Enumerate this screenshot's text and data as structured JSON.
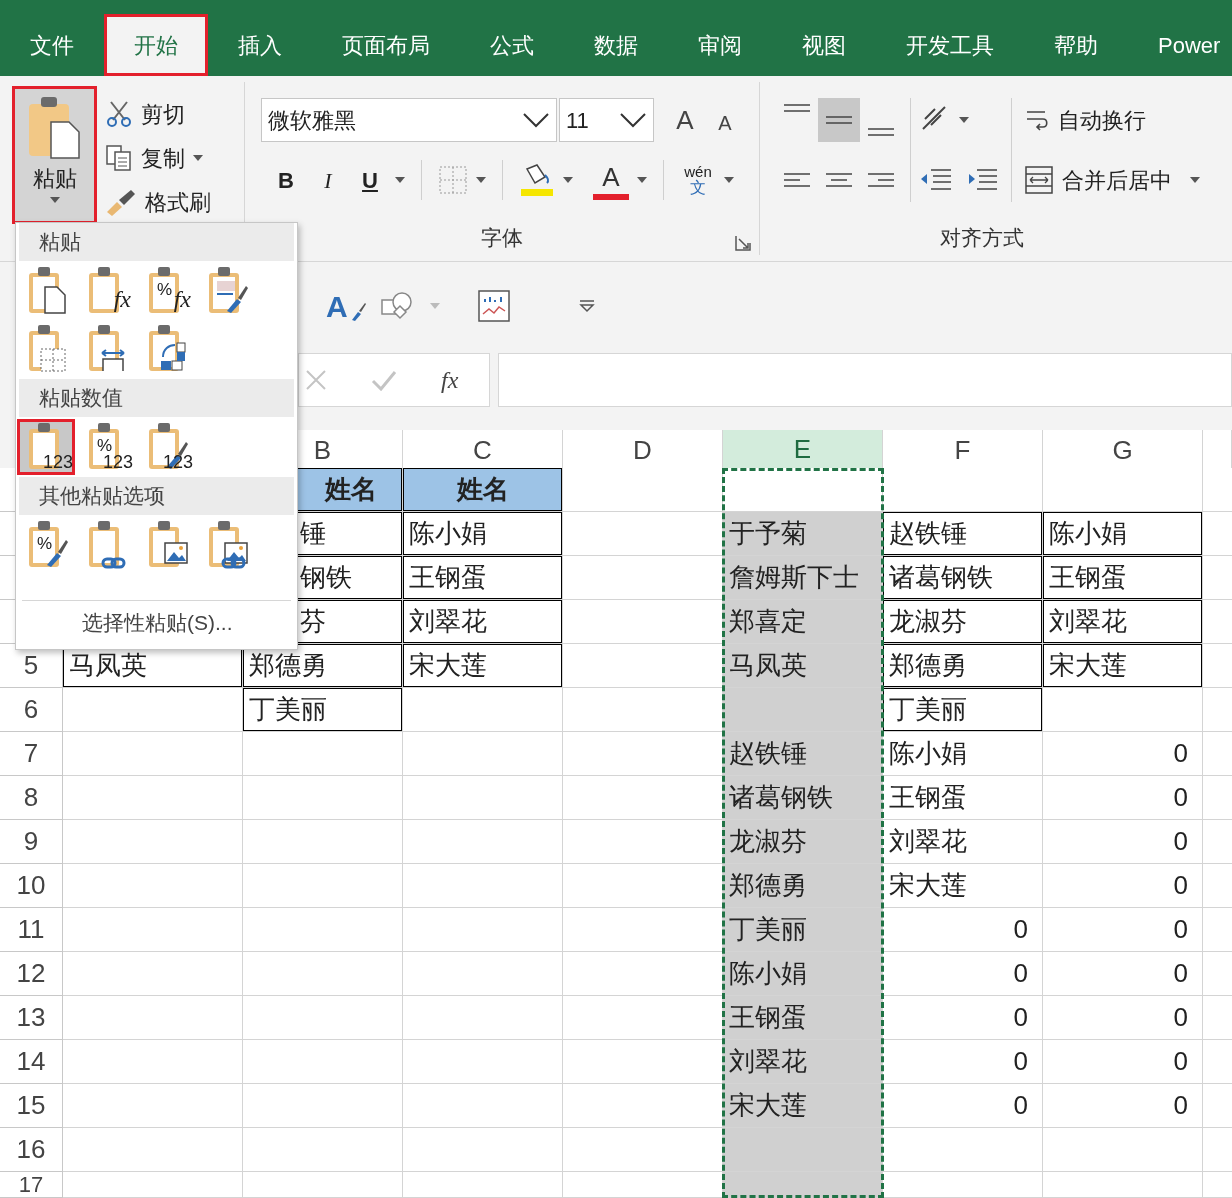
{
  "tabs": [
    {
      "label": "文件",
      "selected": false,
      "highlighted": false
    },
    {
      "label": "开始",
      "selected": true,
      "highlighted": true
    },
    {
      "label": "插入",
      "selected": false,
      "highlighted": false
    },
    {
      "label": "页面布局",
      "selected": false,
      "highlighted": false
    },
    {
      "label": "公式",
      "selected": false,
      "highlighted": false
    },
    {
      "label": "数据",
      "selected": false,
      "highlighted": false
    },
    {
      "label": "审阅",
      "selected": false,
      "highlighted": false
    },
    {
      "label": "视图",
      "selected": false,
      "highlighted": false
    },
    {
      "label": "开发工具",
      "selected": false,
      "highlighted": false
    },
    {
      "label": "帮助",
      "selected": false,
      "highlighted": false
    },
    {
      "label": "Power",
      "selected": false,
      "highlighted": false
    }
  ],
  "ribbon": {
    "clipboard": {
      "paste": {
        "label": "粘贴",
        "highlighted": true
      },
      "cut": "剪切",
      "copy": "复制",
      "format_painter": "格式刷"
    },
    "font": {
      "font_name": "微软雅黑",
      "font_size": "11",
      "grow": "A",
      "shrink": "A",
      "bold": "B",
      "italic": "I",
      "underline": "U",
      "font_color": "A",
      "phonetic": "wén",
      "phonetic_char": "文",
      "group_label": "字体"
    },
    "alignment": {
      "vertical": [
        {
          "kind": "top",
          "selected": false
        },
        {
          "kind": "middle",
          "selected": true
        },
        {
          "kind": "bottom",
          "selected": false
        }
      ],
      "horizontal": [
        {
          "kind": "left",
          "selected": false
        },
        {
          "kind": "center",
          "selected": false
        },
        {
          "kind": "right",
          "selected": false
        }
      ],
      "wrap_text": "自动换行",
      "merge_center": "合并后居中",
      "group_label": "对齐方式"
    }
  },
  "quick_access": {
    "style_letter": "A"
  },
  "formula_bar": {
    "fx": "fx"
  },
  "sheet": {
    "columns": [
      {},
      {
        "label": "B",
        "selected": false
      },
      {
        "label": "C",
        "selected": false
      },
      {
        "label": "D",
        "selected": false
      },
      {
        "label": "E",
        "selected": true
      },
      {
        "label": "F",
        "selected": false
      },
      {
        "label": "G",
        "selected": false
      },
      {}
    ],
    "rows": [
      {
        "cells": [
          {},
          {
            "text": "姓名",
            "kind": "head"
          },
          {
            "text": "姓名",
            "kind": "head"
          },
          {},
          {},
          {},
          {}
        ]
      },
      {
        "cells": [
          {},
          {
            "text": "锤",
            "kind": "box"
          },
          {
            "text": "陈小娟",
            "kind": "box"
          },
          {},
          {
            "text": "于予菊",
            "kind": "fill"
          },
          {
            "text": "赵铁锤",
            "kind": "box"
          },
          {
            "text": "陈小娟",
            "kind": "box"
          }
        ]
      },
      {
        "cells": [
          {},
          {
            "text": "钢铁",
            "kind": "box"
          },
          {
            "text": "王钢蛋",
            "kind": "box"
          },
          {},
          {
            "text": "詹姆斯下士",
            "kind": "fill"
          },
          {
            "text": "诸葛钢铁",
            "kind": "box"
          },
          {
            "text": "王钢蛋",
            "kind": "box"
          }
        ]
      },
      {
        "cells": [
          {},
          {
            "text": "芬",
            "kind": "box"
          },
          {
            "text": "刘翠花",
            "kind": "box"
          },
          {},
          {
            "text": "郑喜定",
            "kind": "fill"
          },
          {
            "text": "龙淑芬",
            "kind": "box"
          },
          {
            "text": "刘翠花",
            "kind": "box"
          }
        ]
      },
      {
        "number": "5",
        "cells": [
          {
            "text": "马凤英",
            "kind": "box"
          },
          {
            "text": "郑德勇",
            "kind": "box"
          },
          {
            "text": "宋大莲",
            "kind": "box"
          },
          {},
          {
            "text": "马凤英",
            "kind": "fill"
          },
          {
            "text": "郑德勇",
            "kind": "box"
          },
          {
            "text": "宋大莲",
            "kind": "box"
          }
        ]
      },
      {
        "number": "6",
        "cells": [
          {},
          {
            "text": "丁美丽",
            "kind": "box"
          },
          {},
          {},
          {
            "kind": "fill"
          },
          {
            "text": "丁美丽",
            "kind": "box"
          },
          {}
        ]
      },
      {
        "number": "7",
        "cells": [
          {},
          {},
          {},
          {},
          {
            "text": "赵铁锤",
            "kind": "fill"
          },
          {
            "text": "陈小娟"
          },
          {
            "text": "0",
            "kind": "number"
          }
        ]
      },
      {
        "number": "8",
        "cells": [
          {},
          {},
          {},
          {},
          {
            "text": "诸葛钢铁",
            "kind": "fill"
          },
          {
            "text": "王钢蛋"
          },
          {
            "text": "0",
            "kind": "number"
          }
        ]
      },
      {
        "number": "9",
        "cells": [
          {},
          {},
          {},
          {},
          {
            "text": "龙淑芬",
            "kind": "fill"
          },
          {
            "text": "刘翠花"
          },
          {
            "text": "0",
            "kind": "number"
          }
        ]
      },
      {
        "number": "10",
        "cells": [
          {},
          {},
          {},
          {},
          {
            "text": "郑德勇",
            "kind": "fill"
          },
          {
            "text": "宋大莲"
          },
          {
            "text": "0",
            "kind": "number"
          }
        ]
      },
      {
        "number": "11",
        "cells": [
          {},
          {},
          {},
          {},
          {
            "text": "丁美丽",
            "kind": "fill"
          },
          {
            "text": "0",
            "kind": "number"
          },
          {
            "text": "0",
            "kind": "number"
          }
        ]
      },
      {
        "number": "12",
        "cells": [
          {},
          {},
          {},
          {},
          {
            "text": "陈小娟",
            "kind": "fill"
          },
          {
            "text": "0",
            "kind": "number"
          },
          {
            "text": "0",
            "kind": "number"
          }
        ]
      },
      {
        "number": "13",
        "cells": [
          {},
          {},
          {},
          {},
          {
            "text": "王钢蛋",
            "kind": "fill"
          },
          {
            "text": "0",
            "kind": "number"
          },
          {
            "text": "0",
            "kind": "number"
          }
        ]
      },
      {
        "number": "14",
        "cells": [
          {},
          {},
          {},
          {},
          {
            "text": "刘翠花",
            "kind": "fill"
          },
          {
            "text": "0",
            "kind": "number"
          },
          {
            "text": "0",
            "kind": "number"
          }
        ]
      },
      {
        "number": "15",
        "cells": [
          {},
          {},
          {},
          {},
          {
            "text": "宋大莲",
            "kind": "fill"
          },
          {
            "text": "0",
            "kind": "number"
          },
          {
            "text": "0",
            "kind": "number"
          }
        ]
      },
      {
        "number": "16",
        "cells": [
          {},
          {},
          {},
          {},
          {
            "kind": "fill"
          },
          {},
          {}
        ]
      },
      {
        "number": "17",
        "cells": [
          {},
          {},
          {},
          {},
          {
            "kind": "fill"
          },
          {},
          {}
        ]
      }
    ]
  },
  "paste_menu": {
    "sections": [
      {
        "title": "粘贴",
        "rows": [
          [
            {
              "kind": "paste",
              "selected": false,
              "highlighted": false
            },
            {
              "kind": "formulas",
              "formula": "fx",
              "selected": false,
              "highlighted": false
            },
            {
              "kind": "formulas_number",
              "symbol": "%",
              "formula": "fx",
              "selected": false,
              "highlighted": false
            },
            {
              "kind": "source_format",
              "selected": false,
              "highlighted": false
            }
          ],
          [
            {
              "kind": "no_borders",
              "selected": false,
              "highlighted": false
            },
            {
              "kind": "column_widths",
              "selected": false,
              "highlighted": false
            },
            {
              "kind": "transpose",
              "selected": false,
              "highlighted": false
            }
          ]
        ]
      },
      {
        "title": "粘贴数值",
        "rows": [
          [
            {
              "kind": "values",
              "label": "123",
              "selected": true,
              "highlighted": true
            },
            {
              "kind": "values_number",
              "symbol": "%",
              "label": "123",
              "selected": false,
              "highlighted": false
            },
            {
              "kind": "values_source",
              "label": "123",
              "selected": false,
              "highlighted": false
            }
          ]
        ]
      },
      {
        "title": "其他粘贴选项",
        "rows": [
          [
            {
              "kind": "formatting",
              "symbol": "%",
              "selected": false,
              "highlighted": false
            },
            {
              "kind": "link",
              "selected": false,
              "highlighted": false
            },
            {
              "kind": "picture",
              "selected": false,
              "highlighted": false
            },
            {
              "kind": "linked_picture",
              "selected": false,
              "highlighted": false
            }
          ]
        ]
      }
    ],
    "footer": "选择性粘贴(S)..."
  }
}
